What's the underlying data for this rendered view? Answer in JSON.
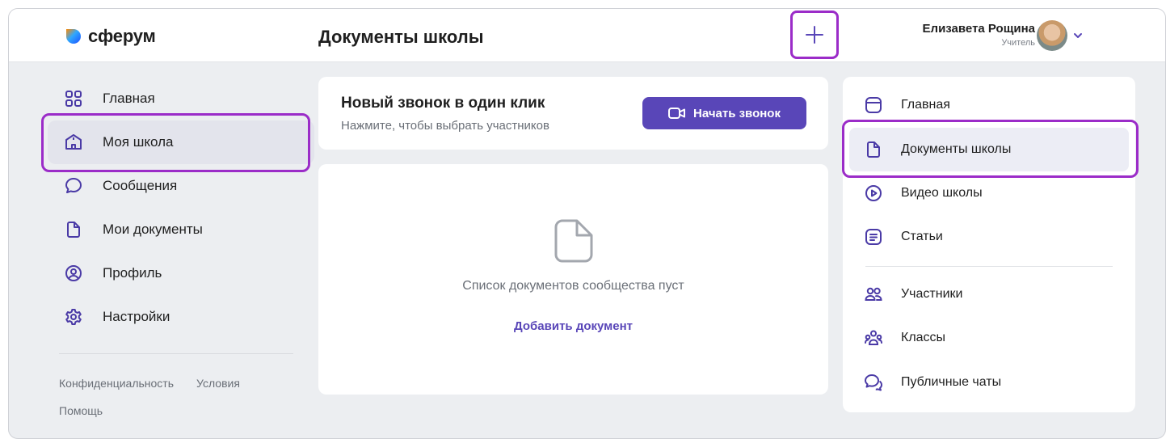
{
  "header": {
    "logo_text": "сферум",
    "page_title": "Документы школы",
    "user": {
      "name": "Елизавета Рощина",
      "role": "Учитель"
    }
  },
  "left_nav": {
    "items": [
      {
        "label": "Главная",
        "icon": "grid-icon"
      },
      {
        "label": "Моя школа",
        "icon": "school-icon"
      },
      {
        "label": "Сообщения",
        "icon": "message-icon"
      },
      {
        "label": "Мои документы",
        "icon": "document-icon"
      },
      {
        "label": "Профиль",
        "icon": "profile-icon"
      },
      {
        "label": "Настройки",
        "icon": "gear-icon"
      }
    ],
    "active_index": 1,
    "footer": {
      "privacy": "Конфиденциальность",
      "terms": "Условия",
      "help": "Помощь"
    }
  },
  "call_card": {
    "title": "Новый звонок в один клик",
    "subtitle": "Нажмите, чтобы выбрать участников",
    "button_label": "Начать звонок"
  },
  "documents": {
    "empty_text": "Список документов сообщества пуст",
    "add_label": "Добавить документ"
  },
  "right_nav": {
    "items": [
      {
        "label": "Главная",
        "icon": "home-panel-icon"
      },
      {
        "label": "Документы школы",
        "icon": "document-icon"
      },
      {
        "label": "Видео школы",
        "icon": "play-icon"
      },
      {
        "label": "Статьи",
        "icon": "article-icon"
      },
      {
        "label": "Участники",
        "icon": "users-icon"
      },
      {
        "label": "Классы",
        "icon": "classes-icon"
      },
      {
        "label": "Публичные чаты",
        "icon": "chats-icon"
      }
    ],
    "active_index": 1
  },
  "colors": {
    "accent": "#5946b8",
    "highlight": "#9b2cc8",
    "icon": "#4a3aa6",
    "background": "#eceef1"
  }
}
